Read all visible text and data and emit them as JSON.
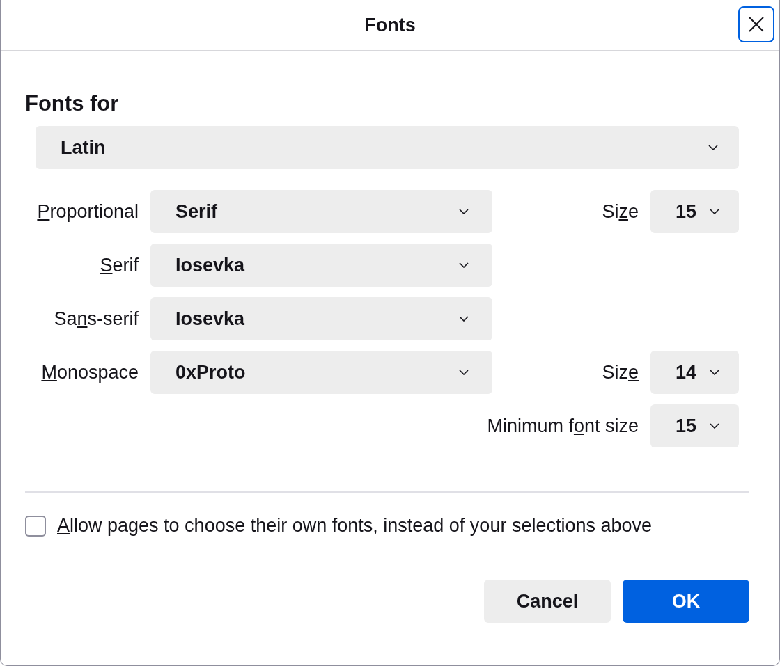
{
  "window": {
    "title": "Fonts"
  },
  "fonts_for": {
    "label": "Fonts for",
    "value": "Latin"
  },
  "rows": [
    {
      "label": [
        {
          "text": "P",
          "underlined": true
        },
        {
          "text": "roportional",
          "underlined": false
        }
      ],
      "value": "Serif",
      "size": {
        "label": [
          {
            "text": "Si",
            "underlined": false
          },
          {
            "text": "z",
            "underlined": true
          },
          {
            "text": "e",
            "underlined": false
          }
        ],
        "value": "15"
      }
    },
    {
      "label": [
        {
          "text": "S",
          "underlined": true
        },
        {
          "text": "erif",
          "underlined": false
        }
      ],
      "value": "Iosevka"
    },
    {
      "label": [
        {
          "text": "Sa",
          "underlined": false
        },
        {
          "text": "n",
          "underlined": true
        },
        {
          "text": "s-serif",
          "underlined": false
        }
      ],
      "value": "Iosevka"
    },
    {
      "label": [
        {
          "text": "M",
          "underlined": true
        },
        {
          "text": "onospace",
          "underlined": false
        }
      ],
      "value": "0xProto",
      "size": {
        "label": [
          {
            "text": "Siz",
            "underlined": false
          },
          {
            "text": "e",
            "underlined": true
          }
        ],
        "value": "14"
      }
    }
  ],
  "minimum_font_size": {
    "label": [
      {
        "text": "Minimum f",
        "underlined": false
      },
      {
        "text": "o",
        "underlined": true
      },
      {
        "text": "nt size",
        "underlined": false
      }
    ],
    "value": "15"
  },
  "allow_pages": {
    "label": [
      {
        "text": "A",
        "underlined": true
      },
      {
        "text": "llow pages to choose their own fonts, instead of your selections above",
        "underlined": false
      }
    ],
    "checked": false
  },
  "buttons": [
    {
      "kind": "secondary",
      "label": "Cancel"
    },
    {
      "kind": "primary",
      "label": "OK"
    }
  ]
}
